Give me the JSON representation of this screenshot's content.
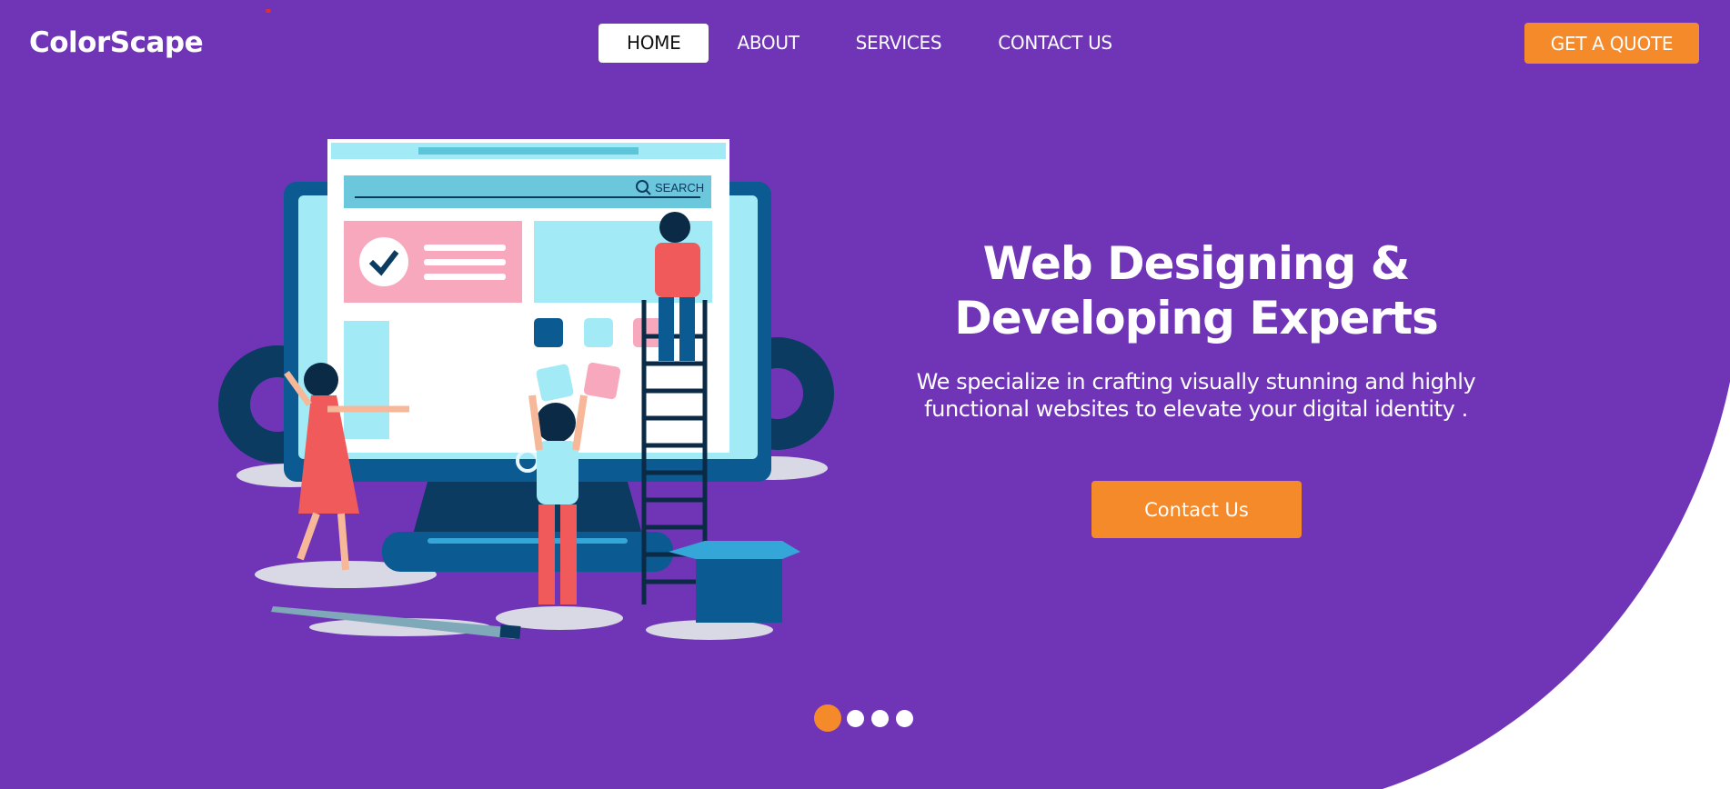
{
  "brand": {
    "name": "ColorScape"
  },
  "nav": {
    "items": [
      {
        "label": "HOME",
        "active": true
      },
      {
        "label": "ABOUT",
        "active": false
      },
      {
        "label": "SERVICES",
        "active": false
      },
      {
        "label": "CONTACT US",
        "active": false
      }
    ]
  },
  "header": {
    "cta_label": "GET A QUOTE"
  },
  "hero": {
    "title_line1": "Web Designing &",
    "title_line2": "Developing Experts",
    "subtitle_line1": "We specialize in crafting visually stunning and highly",
    "subtitle_line2": "functional websites to elevate your digital identity .",
    "cta_label": "Contact Us"
  },
  "illustration": {
    "search_label": "SEARCH"
  },
  "carousel": {
    "slide_count": 4,
    "active_index": 0
  },
  "colors": {
    "background": "#7035b7",
    "accent": "#f58a2b",
    "text": "#ffffff",
    "monitor": "#0b5a91",
    "screen": "#a3eaf7",
    "pink": "#f7a8bd",
    "red": "#f05a5a"
  }
}
